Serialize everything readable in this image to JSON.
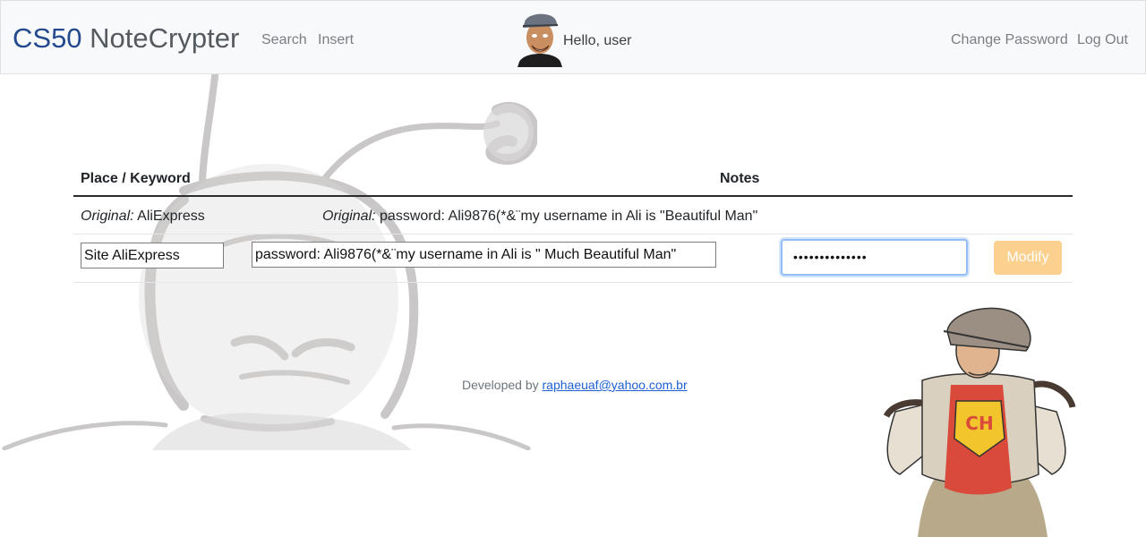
{
  "navbar": {
    "brand_cs": "CS50",
    "brand_rest": " NoteCrypter",
    "links": {
      "search": "Search",
      "insert": "Insert"
    },
    "greeting": "Hello, user",
    "right_links": {
      "change_password": "Change Password",
      "logout": "Log Out"
    }
  },
  "table": {
    "headers": {
      "place": "Place / Keyword",
      "notes": "Notes"
    },
    "original_label": "Original:",
    "original_place": "AliExpress",
    "original_notes": "password: Ali9876(*&¨my username in Ali is \"Beautiful Man\"",
    "edit": {
      "place_value": "Site AliExpress",
      "notes_value": "password: Ali9876(*&¨my username in Ali is \" Much Beautiful Man\"",
      "password_mask": "••••••••••••••",
      "modify_label": "Modify"
    }
  },
  "footer": {
    "prefix": "Developed by",
    "email": "raphaeuaf@yahoo.com.br"
  },
  "colors": {
    "brand_cs": "#234a8f",
    "modify_button": "#fcd08e",
    "focus_border": "#92bdf5"
  }
}
